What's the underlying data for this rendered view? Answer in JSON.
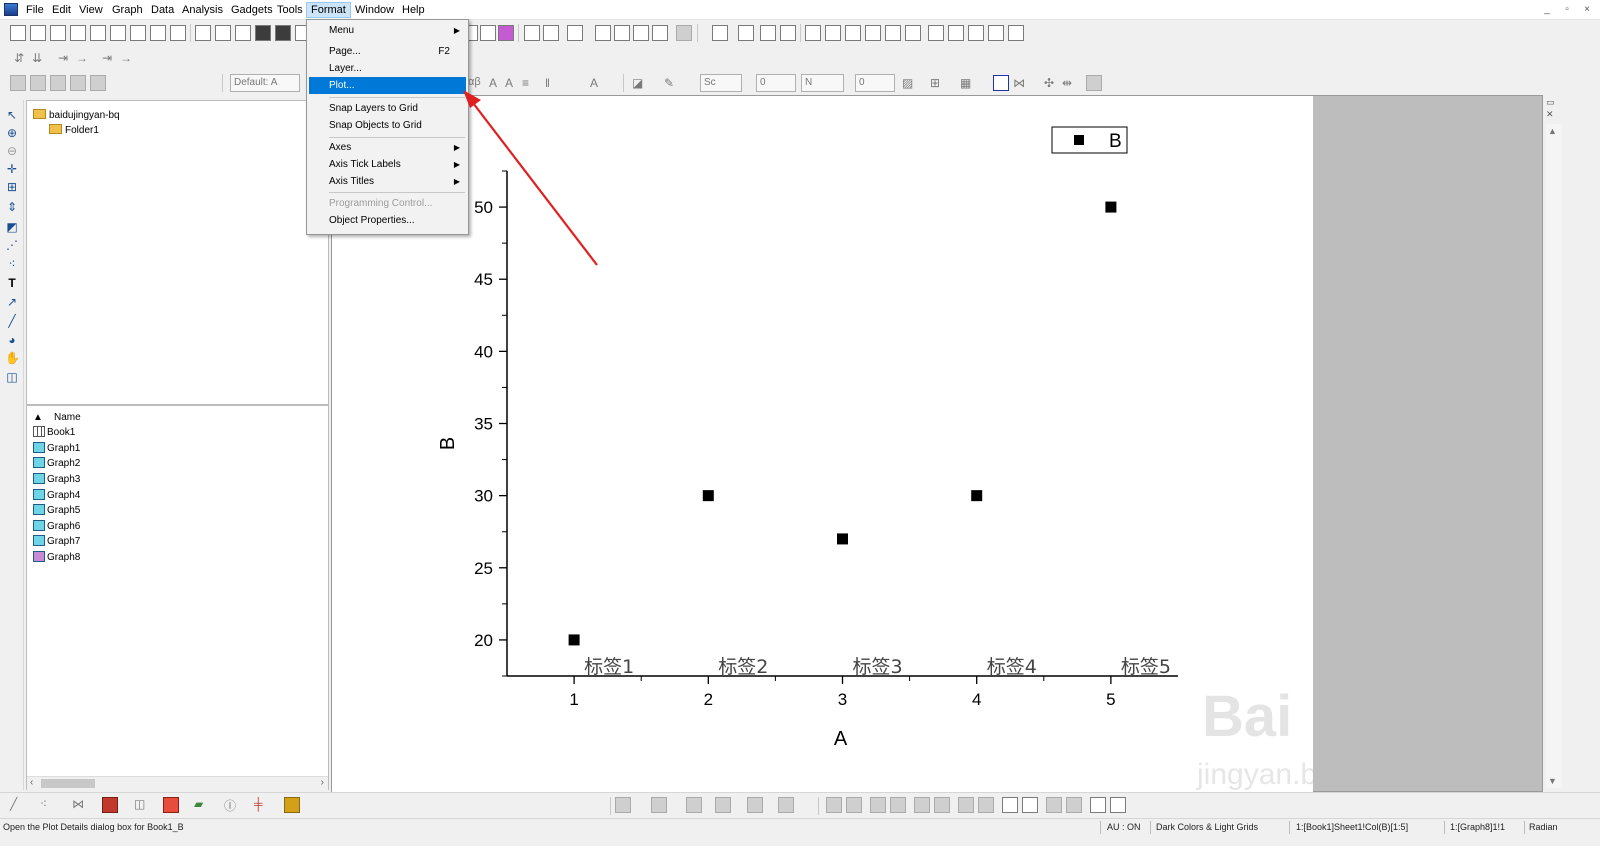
{
  "menubar": {
    "items": [
      "File",
      "Edit",
      "View",
      "Graph",
      "Data",
      "Analysis",
      "Gadgets",
      "Tools",
      "Format",
      "Window",
      "Help"
    ],
    "active": "Format"
  },
  "toolbar": {
    "font_combo": "Default: A",
    "line_style_combo": "Sc",
    "line_width_combo": "0",
    "fill_combo": "N",
    "fill_width_combo": "0",
    "greek_label": "αβ"
  },
  "format_menu": {
    "items": [
      {
        "label": "Menu",
        "shortcut": "",
        "submenu": true,
        "disabled": false,
        "selected": false
      },
      {
        "label": "Page...",
        "shortcut": "F2",
        "submenu": false,
        "disabled": false,
        "selected": false
      },
      {
        "label": "Layer...",
        "shortcut": "",
        "submenu": false,
        "disabled": false,
        "selected": false
      },
      {
        "label": "Plot...",
        "shortcut": "",
        "submenu": false,
        "disabled": false,
        "selected": true
      },
      {
        "label": "Snap Layers to Grid",
        "shortcut": "",
        "submenu": false,
        "disabled": false,
        "selected": false
      },
      {
        "label": "Snap Objects to Grid",
        "shortcut": "",
        "submenu": false,
        "disabled": false,
        "selected": false
      },
      {
        "label": "Axes",
        "shortcut": "",
        "submenu": true,
        "disabled": false,
        "selected": false
      },
      {
        "label": "Axis Tick Labels",
        "shortcut": "",
        "submenu": true,
        "disabled": false,
        "selected": false
      },
      {
        "label": "Axis Titles",
        "shortcut": "",
        "submenu": true,
        "disabled": false,
        "selected": false
      },
      {
        "label": "Programming Control...",
        "shortcut": "",
        "submenu": false,
        "disabled": true,
        "selected": false
      },
      {
        "label": "Object Properties...",
        "shortcut": "",
        "submenu": false,
        "disabled": false,
        "selected": false
      }
    ]
  },
  "explorer": {
    "root": "baidujingyan-bq",
    "folder": "Folder1",
    "list_header": "Name",
    "items": [
      {
        "name": "Book1",
        "icon": "workbook-icon"
      },
      {
        "name": "Graph1",
        "icon": "graph-icon"
      },
      {
        "name": "Graph2",
        "icon": "graph-icon"
      },
      {
        "name": "Graph3",
        "icon": "graph-icon"
      },
      {
        "name": "Graph4",
        "icon": "graph-icon"
      },
      {
        "name": "Graph5",
        "icon": "graph-icon"
      },
      {
        "name": "Graph6",
        "icon": "graph-icon"
      },
      {
        "name": "Graph7",
        "icon": "graph-icon"
      },
      {
        "name": "Graph8",
        "icon": "graph-icon"
      }
    ]
  },
  "chart_data": {
    "type": "scatter",
    "title": "",
    "xlabel": "A",
    "ylabel": "B",
    "x": [
      1,
      2,
      3,
      4,
      5
    ],
    "series": [
      {
        "name": "B",
        "values": [
          20,
          30,
          27,
          30,
          50
        ]
      }
    ],
    "point_labels": [
      "标签1",
      "标签2",
      "标签3",
      "标签4",
      "标签5"
    ],
    "xlim": [
      0.5,
      5.5
    ],
    "ylim": [
      17.5,
      52.5
    ],
    "x_ticks": [
      1,
      2,
      3,
      4,
      5
    ],
    "y_ticks": [
      20,
      25,
      30,
      35,
      40,
      45,
      50
    ],
    "grid": false,
    "legend": "top-right",
    "marker": "square",
    "color": "#000000"
  },
  "watermark": {
    "brand": "Baidu经验",
    "url": "jingyan.baidu.com"
  },
  "statusbar": {
    "message": "Open the Plot Details dialog box for Book1_B",
    "au": "AU : ON",
    "theme": "Dark Colors & Light Grids",
    "range": "1:[Book1]Sheet1!Col(B)[1:5]",
    "graph": "1:[Graph8]1!1",
    "angle": "Radian"
  },
  "colors": {
    "menu_highlight": "#0078d7",
    "arrow": "#e02020",
    "page_background": "#ffffff",
    "frame_background": "#bdbdbd"
  }
}
